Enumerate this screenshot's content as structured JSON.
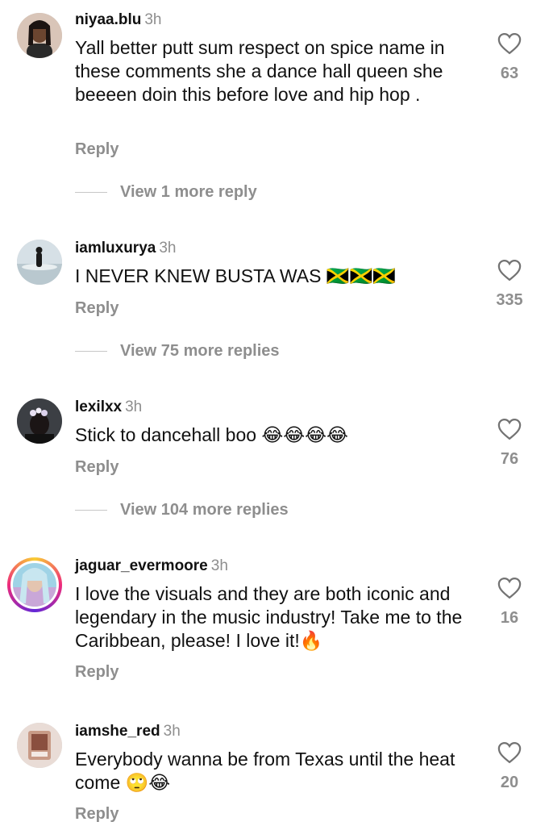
{
  "comments": [
    {
      "username": "niyaa.blu",
      "time": "3h",
      "text": "Yall better putt sum respect on spice name in these comments she a dance hall queen she beeeen doin this  before love and hip hop .",
      "likes": "63",
      "reply_label": "Reply",
      "view_more": "View 1 more reply",
      "avatar_icon": "user-avatar-icon"
    },
    {
      "username": "iamluxurya",
      "time": "3h",
      "text": "I NEVER KNEW BUSTA WAS 🇯🇲🇯🇲🇯🇲",
      "likes": "335",
      "reply_label": "Reply",
      "view_more": "View 75 more replies",
      "avatar_icon": "user-avatar-icon"
    },
    {
      "username": "lexilxx",
      "time": "3h",
      "text": "Stick to dancehall boo 😂😂😂😂",
      "likes": "76",
      "reply_label": "Reply",
      "view_more": "View 104 more replies",
      "avatar_icon": "user-avatar-icon"
    },
    {
      "username": "jaguar_evermoore",
      "time": "3h",
      "text": "I love the visuals and they are both iconic and legendary in the music industry! Take me to the Caribbean, please! I love it!🔥",
      "likes": "16",
      "reply_label": "Reply",
      "avatar_icon": "user-avatar-story-icon"
    },
    {
      "username": "iamshe_red",
      "time": "3h",
      "text": "Everybody wanna be from Texas until the heat come 🙄😂",
      "likes": "20",
      "reply_label": "Reply",
      "avatar_icon": "user-avatar-icon"
    }
  ],
  "colors": {
    "text": "#111111",
    "secondary": "#8e8e8e",
    "divider": "#c7c7c7"
  }
}
